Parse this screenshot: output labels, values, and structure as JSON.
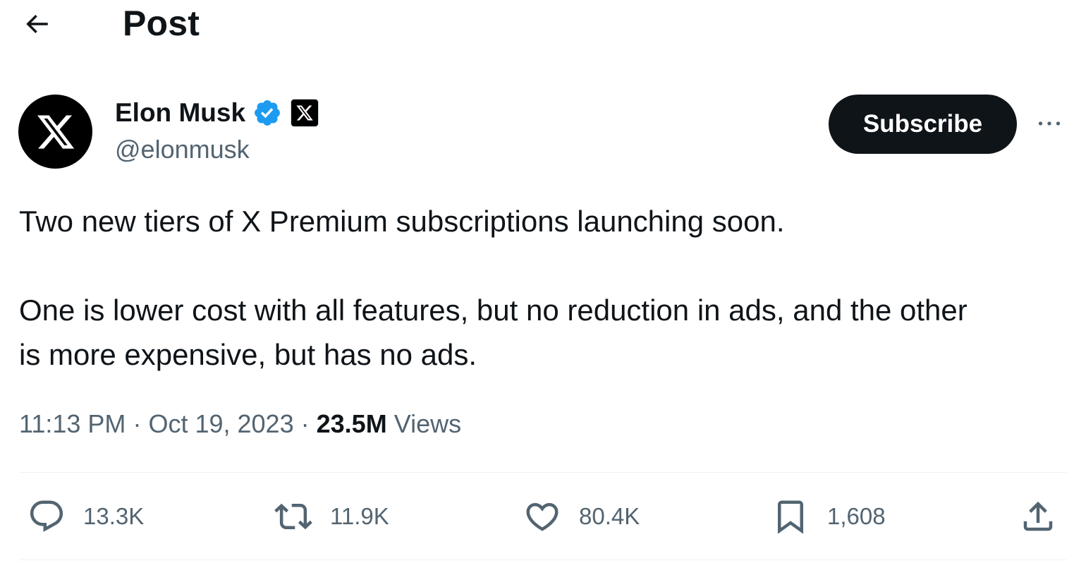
{
  "header": {
    "title": "Post",
    "back_icon": "arrow-left-icon"
  },
  "author": {
    "name": "Elon Musk",
    "handle": "@elonmusk",
    "avatar_icon": "x-logo-icon",
    "verified_icon": "verified-badge-icon",
    "affiliate_icon": "x-logo-icon",
    "verified_color": "#1d9bf0"
  },
  "subscribe": {
    "label": "Subscribe"
  },
  "more_icon": "more-horizontal-icon",
  "post": {
    "paragraphs": [
      "Two new tiers of X Premium subscriptions launching soon.",
      "One is lower cost with all features, but no reduction in ads, and the other",
      "is more expensive, but has no ads."
    ]
  },
  "meta": {
    "time": "11:13 PM",
    "separator": "·",
    "date": "Oct 19, 2023",
    "views_count": "23.5M",
    "views_label": "Views"
  },
  "actions": {
    "reply": {
      "icon": "reply-icon",
      "count": "13.3K"
    },
    "repost": {
      "icon": "repost-icon",
      "count": "11.9K"
    },
    "like": {
      "icon": "heart-icon",
      "count": "80.4K"
    },
    "bookmark": {
      "icon": "bookmark-icon",
      "count": "1,608"
    },
    "share": {
      "icon": "share-icon"
    }
  },
  "colors": {
    "text_primary": "#0f1419",
    "text_secondary": "#536471",
    "accent": "#1d9bf0",
    "divider": "#eff3f4"
  }
}
